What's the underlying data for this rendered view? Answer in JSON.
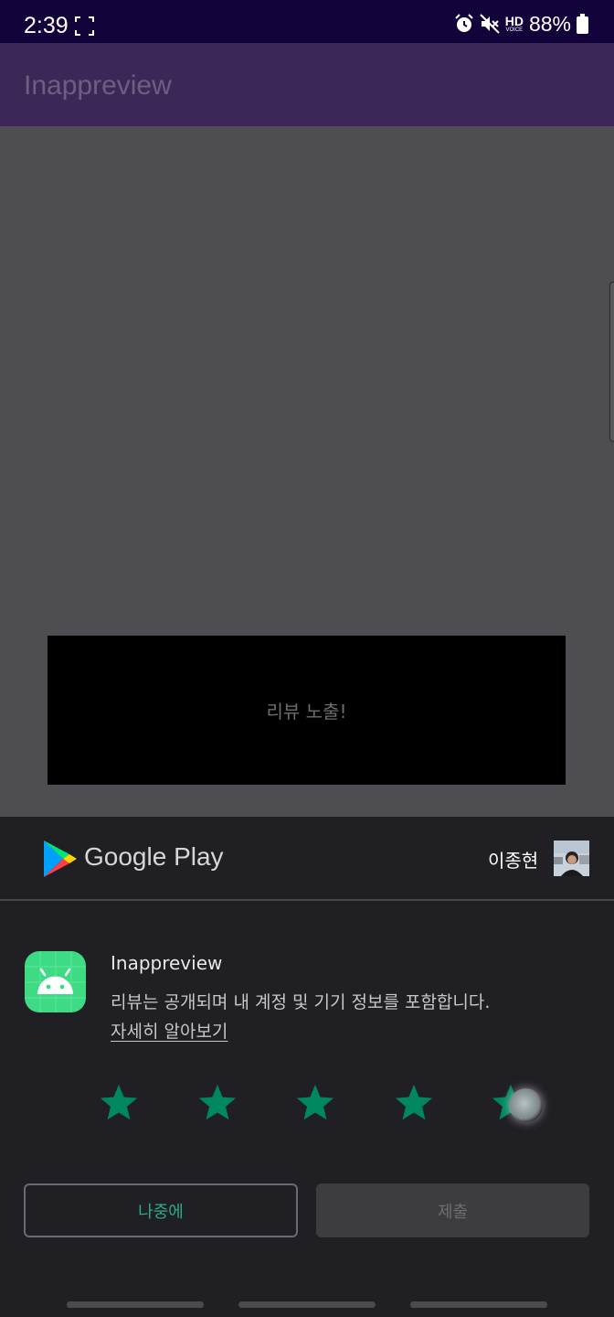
{
  "status_bar": {
    "time": "2:39",
    "hd_label": "HD",
    "voice_label": "VOICE",
    "battery": "88%",
    "icons": [
      "screenshot-icon",
      "alarm-icon",
      "mute-icon",
      "hd-voice-icon",
      "battery-icon"
    ]
  },
  "app_bar": {
    "title": "Inappreview"
  },
  "main": {
    "review_button_label": "리뷰 노출!"
  },
  "review_sheet": {
    "brand": "Google Play",
    "account_name": "이종현",
    "app_name": "Inappreview",
    "disclaimer": "리뷰는 공개되며 내 계정 및 기기 정보를 포함합니다.",
    "learn_more": "자세히 알아보기",
    "rating": 5,
    "max_rating": 5,
    "later_label": "나중에",
    "submit_label": "제출",
    "colors": {
      "accent": "#01875f",
      "later_text": "#2ea98a",
      "android_green": "#3ddc84"
    }
  }
}
